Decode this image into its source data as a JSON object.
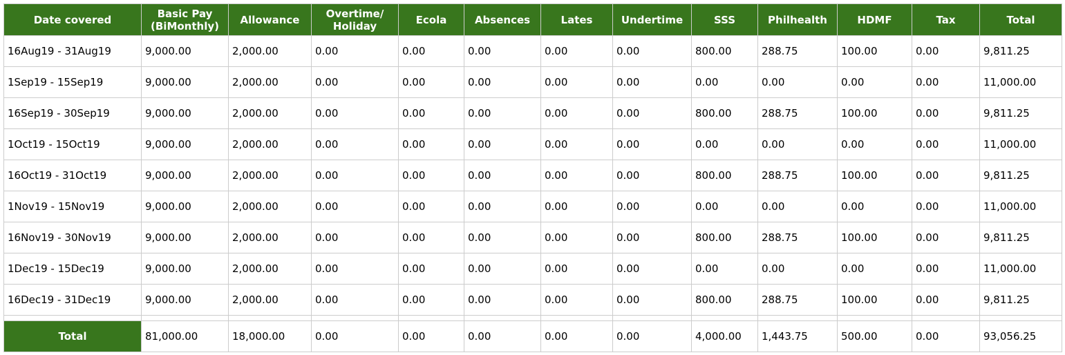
{
  "table": {
    "headers": [
      "Date covered",
      "Basic Pay (BiMonthly)",
      "Allowance",
      "Overtime/ Holiday",
      "Ecola",
      "Absences",
      "Lates",
      "Undertime",
      "SSS",
      "Philhealth",
      "HDMF",
      "Tax",
      "Total"
    ],
    "rows": [
      [
        "16Aug19 - 31Aug19",
        "9,000.00",
        "2,000.00",
        "0.00",
        "0.00",
        "0.00",
        "0.00",
        "0.00",
        "800.00",
        "288.75",
        "100.00",
        "0.00",
        "9,811.25"
      ],
      [
        "1Sep19 - 15Sep19",
        "9,000.00",
        "2,000.00",
        "0.00",
        "0.00",
        "0.00",
        "0.00",
        "0.00",
        "0.00",
        "0.00",
        "0.00",
        "0.00",
        "11,000.00"
      ],
      [
        "16Sep19 - 30Sep19",
        "9,000.00",
        "2,000.00",
        "0.00",
        "0.00",
        "0.00",
        "0.00",
        "0.00",
        "800.00",
        "288.75",
        "100.00",
        "0.00",
        "9,811.25"
      ],
      [
        "1Oct19 - 15Oct19",
        "9,000.00",
        "2,000.00",
        "0.00",
        "0.00",
        "0.00",
        "0.00",
        "0.00",
        "0.00",
        "0.00",
        "0.00",
        "0.00",
        "11,000.00"
      ],
      [
        "16Oct19 - 31Oct19",
        "9,000.00",
        "2,000.00",
        "0.00",
        "0.00",
        "0.00",
        "0.00",
        "0.00",
        "800.00",
        "288.75",
        "100.00",
        "0.00",
        "9,811.25"
      ],
      [
        "1Nov19 - 15Nov19",
        "9,000.00",
        "2,000.00",
        "0.00",
        "0.00",
        "0.00",
        "0.00",
        "0.00",
        "0.00",
        "0.00",
        "0.00",
        "0.00",
        "11,000.00"
      ],
      [
        "16Nov19 - 30Nov19",
        "9,000.00",
        "2,000.00",
        "0.00",
        "0.00",
        "0.00",
        "0.00",
        "0.00",
        "800.00",
        "288.75",
        "100.00",
        "0.00",
        "9,811.25"
      ],
      [
        "1Dec19 - 15Dec19",
        "9,000.00",
        "2,000.00",
        "0.00",
        "0.00",
        "0.00",
        "0.00",
        "0.00",
        "0.00",
        "0.00",
        "0.00",
        "0.00",
        "11,000.00"
      ],
      [
        "16Dec19 - 31Dec19",
        "9,000.00",
        "2,000.00",
        "0.00",
        "0.00",
        "0.00",
        "0.00",
        "0.00",
        "800.00",
        "288.75",
        "100.00",
        "0.00",
        "9,811.25"
      ]
    ],
    "total_row": {
      "label": "Total",
      "values": [
        "81,000.00",
        "18,000.00",
        "0.00",
        "0.00",
        "0.00",
        "0.00",
        "0.00",
        "4,000.00",
        "1,443.75",
        "500.00",
        "0.00",
        "93,056.25"
      ]
    }
  },
  "colors": {
    "header_bg": "#38761d",
    "header_text": "#ffffff",
    "border": "#cccccc"
  }
}
